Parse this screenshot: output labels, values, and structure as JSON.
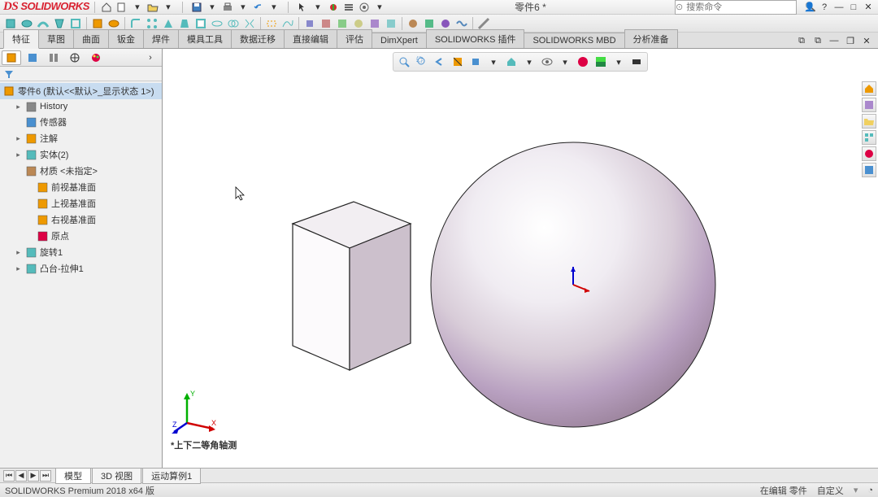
{
  "app": {
    "name": "SOLIDWORKS",
    "doc_title": "零件6 *"
  },
  "search": {
    "placeholder": "搜索命令"
  },
  "ribbon_tabs": [
    "特征",
    "草图",
    "曲面",
    "钣金",
    "焊件",
    "模具工具",
    "数据迁移",
    "直接编辑",
    "评估",
    "DimXpert",
    "SOLIDWORKS 插件",
    "SOLIDWORKS MBD",
    "分析准备"
  ],
  "ribbon_active": 0,
  "tree": {
    "root": "零件6  (默认<<默认>_显示状态 1>)",
    "items": [
      {
        "label": "History",
        "icon": "history",
        "exp": true,
        "level": 1
      },
      {
        "label": "传感器",
        "icon": "sensor",
        "level": 1
      },
      {
        "label": "注解",
        "icon": "annotation",
        "exp": true,
        "level": 1
      },
      {
        "label": "实体(2)",
        "icon": "solid",
        "exp": true,
        "level": 1
      },
      {
        "label": "材质 <未指定>",
        "icon": "material",
        "level": 1
      },
      {
        "label": "前视基准面",
        "icon": "plane",
        "level": 2
      },
      {
        "label": "上视基准面",
        "icon": "plane",
        "level": 2
      },
      {
        "label": "右视基准面",
        "icon": "plane",
        "level": 2
      },
      {
        "label": "原点",
        "icon": "origin",
        "level": 2
      },
      {
        "label": "旋转1",
        "icon": "revolve",
        "exp": true,
        "level": 1
      },
      {
        "label": "凸台-拉伸1",
        "icon": "extrude",
        "exp": true,
        "level": 1
      }
    ]
  },
  "view_label": "*上下二等角轴测",
  "bottom_tabs": [
    "模型",
    "3D 视图",
    "运动算例1"
  ],
  "bottom_active": 0,
  "status": {
    "version": "SOLIDWORKS Premium 2018 x64 版",
    "mode": "在编辑 零件",
    "custom": "自定义"
  },
  "triad": {
    "x": "X",
    "y": "Y",
    "z": "Z"
  }
}
